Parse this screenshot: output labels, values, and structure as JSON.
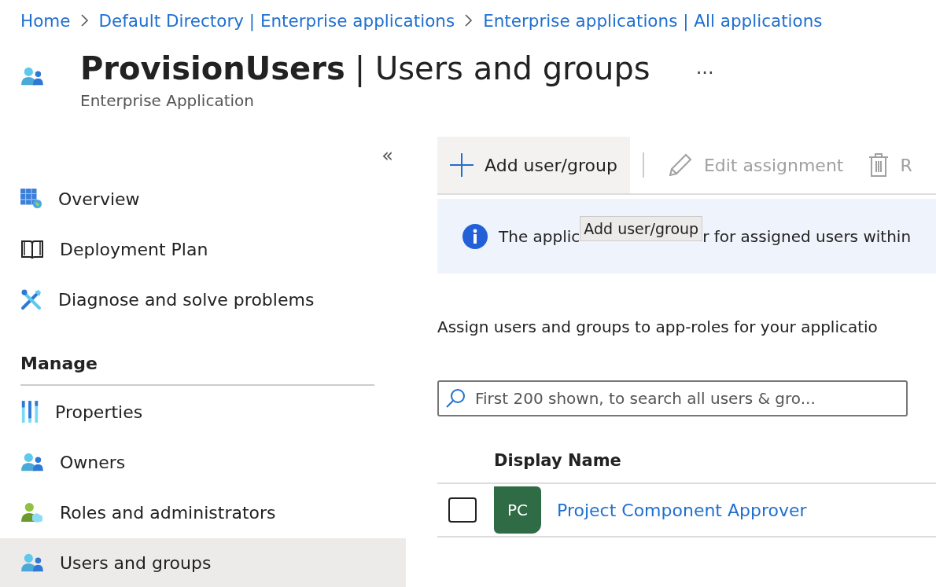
{
  "breadcrumb": [
    "Home",
    "Default Directory | Enterprise applications",
    "Enterprise applications | All applications"
  ],
  "header": {
    "title_bold": "ProvisionUsers",
    "title_rest": "| Users and groups",
    "more": "···",
    "subtitle": "Enterprise Application"
  },
  "sidebar": {
    "collapse": "«",
    "items": [
      {
        "label": "Overview",
        "selected": false
      },
      {
        "label": "Deployment Plan",
        "selected": false
      },
      {
        "label": "Diagnose and solve problems",
        "selected": false
      }
    ],
    "sections": [
      {
        "title": "Manage",
        "items": [
          {
            "label": "Properties",
            "selected": false
          },
          {
            "label": "Owners",
            "selected": false
          },
          {
            "label": "Roles and administrators",
            "selected": false
          },
          {
            "label": "Users and groups",
            "selected": true
          }
        ]
      }
    ]
  },
  "toolbar": [
    {
      "kind": "add",
      "label": "Add user/group",
      "disabled": false,
      "hovered": true
    },
    {
      "kind": "edit",
      "label": "Edit assignment",
      "disabled": true,
      "hovered": false
    },
    {
      "kind": "remove",
      "label": "R",
      "disabled": true,
      "hovered": false
    }
  ],
  "tooltip": "Add user/group",
  "info_bar": {
    "text_before": "The applic",
    "text_after": "r for assigned users within"
  },
  "description": "Assign users and groups to app-roles for your applicatio",
  "search": {
    "placeholder": "First 200 shown, to search all users & gro..."
  },
  "table": {
    "columns": [
      "Display Name"
    ],
    "rows": [
      {
        "selected": false,
        "initials": "PC",
        "color": "#2f6b45",
        "name": "Project Component Approver"
      }
    ]
  }
}
